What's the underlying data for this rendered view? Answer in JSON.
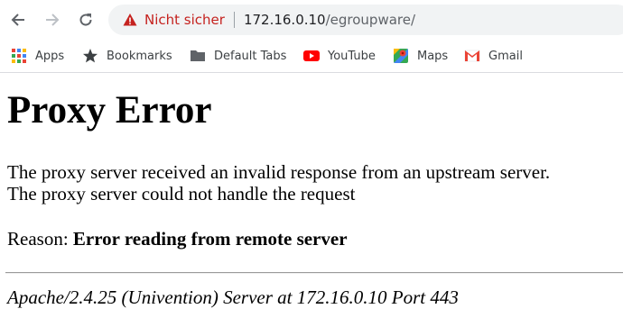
{
  "browser": {
    "omnibox": {
      "security_label": "Nicht sicher",
      "url_host": "172.16.0.10",
      "url_path": "/egroupware/"
    },
    "bookmarks": [
      {
        "label": "Apps",
        "icon": "apps-grid-icon"
      },
      {
        "label": "Bookmarks",
        "icon": "star-icon"
      },
      {
        "label": "Default Tabs",
        "icon": "folder-icon"
      },
      {
        "label": "YouTube",
        "icon": "youtube-icon"
      },
      {
        "label": "Maps",
        "icon": "maps-icon"
      },
      {
        "label": "Gmail",
        "icon": "gmail-icon"
      }
    ]
  },
  "page": {
    "title": "Proxy Error",
    "message_line1": "The proxy server received an invalid response from an upstream server.",
    "message_line2": "The proxy server could not handle the request",
    "reason_label": "Reason:",
    "reason_text": "Error reading from remote server",
    "footer": "Apache/2.4.25 (Univention) Server at 172.16.0.10 Port 443"
  },
  "colors": {
    "security_warning": "#c5221f",
    "omnibox_bg": "#f1f3f4"
  }
}
